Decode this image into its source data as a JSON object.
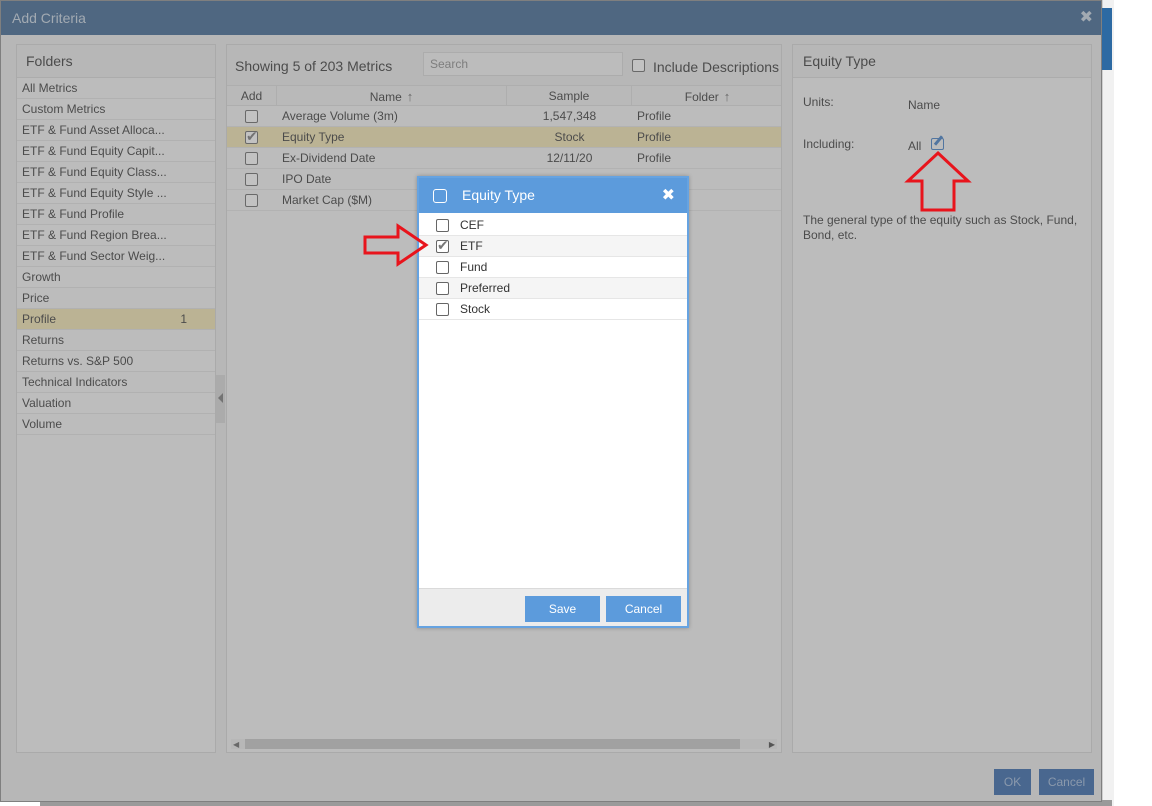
{
  "dialog": {
    "title": "Add Criteria",
    "close_icon": "close-icon",
    "ok_label": "OK",
    "cancel_label": "Cancel"
  },
  "folders": {
    "header": "Folders",
    "items": [
      {
        "label": "All Metrics",
        "count": ""
      },
      {
        "label": "Custom Metrics",
        "count": ""
      },
      {
        "label": "ETF & Fund Asset Alloca...",
        "count": ""
      },
      {
        "label": "ETF & Fund Equity Capit...",
        "count": ""
      },
      {
        "label": "ETF & Fund Equity Class...",
        "count": ""
      },
      {
        "label": "ETF & Fund Equity Style ...",
        "count": ""
      },
      {
        "label": "ETF & Fund Profile",
        "count": ""
      },
      {
        "label": "ETF & Fund Region Brea...",
        "count": ""
      },
      {
        "label": "ETF & Fund Sector Weig...",
        "count": ""
      },
      {
        "label": "Growth",
        "count": ""
      },
      {
        "label": "Price",
        "count": ""
      },
      {
        "label": "Profile",
        "count": "1"
      },
      {
        "label": "Returns",
        "count": ""
      },
      {
        "label": "Returns vs. S&P 500",
        "count": ""
      },
      {
        "label": "Technical Indicators",
        "count": ""
      },
      {
        "label": "Valuation",
        "count": ""
      },
      {
        "label": "Volume",
        "count": ""
      }
    ]
  },
  "metrics": {
    "showing": "Showing 5 of 203 Metrics",
    "search_placeholder": "Search",
    "include_descriptions": "Include Descriptions",
    "columns": {
      "add": "Add",
      "name": "Name",
      "sample": "Sample",
      "folder": "Folder"
    },
    "rows": [
      {
        "name": "Average Volume (3m)",
        "sample": "1,547,348",
        "folder": "Profile",
        "checked": false
      },
      {
        "name": "Equity Type",
        "sample": "Stock",
        "folder": "Profile",
        "checked": true
      },
      {
        "name": "Ex-Dividend Date",
        "sample": "12/11/20",
        "folder": "Profile",
        "checked": false
      },
      {
        "name": "IPO Date",
        "sample": "",
        "folder": "",
        "checked": false
      },
      {
        "name": "Market Cap ($M)",
        "sample": "",
        "folder": "",
        "checked": false
      }
    ]
  },
  "detail": {
    "title": "Equity Type",
    "units_label": "Units:",
    "units_value": "Name",
    "including_label": "Including:",
    "including_value": "All",
    "edit_icon": "edit-icon",
    "description": "The general type of the equity such as Stock, Fund, Bond, etc."
  },
  "equity_modal": {
    "title": "Equity Type",
    "options": [
      {
        "label": "CEF",
        "checked": false
      },
      {
        "label": "ETF",
        "checked": true
      },
      {
        "label": "Fund",
        "checked": false
      },
      {
        "label": "Preferred",
        "checked": false
      },
      {
        "label": "Stock",
        "checked": false
      }
    ],
    "save_label": "Save",
    "cancel_label": "Cancel"
  },
  "colors": {
    "titlebar": "#3a6390",
    "modal_accent": "#5c9bdc",
    "selected_row": "#f3e5b0",
    "annotation_arrow": "#e8141c"
  }
}
